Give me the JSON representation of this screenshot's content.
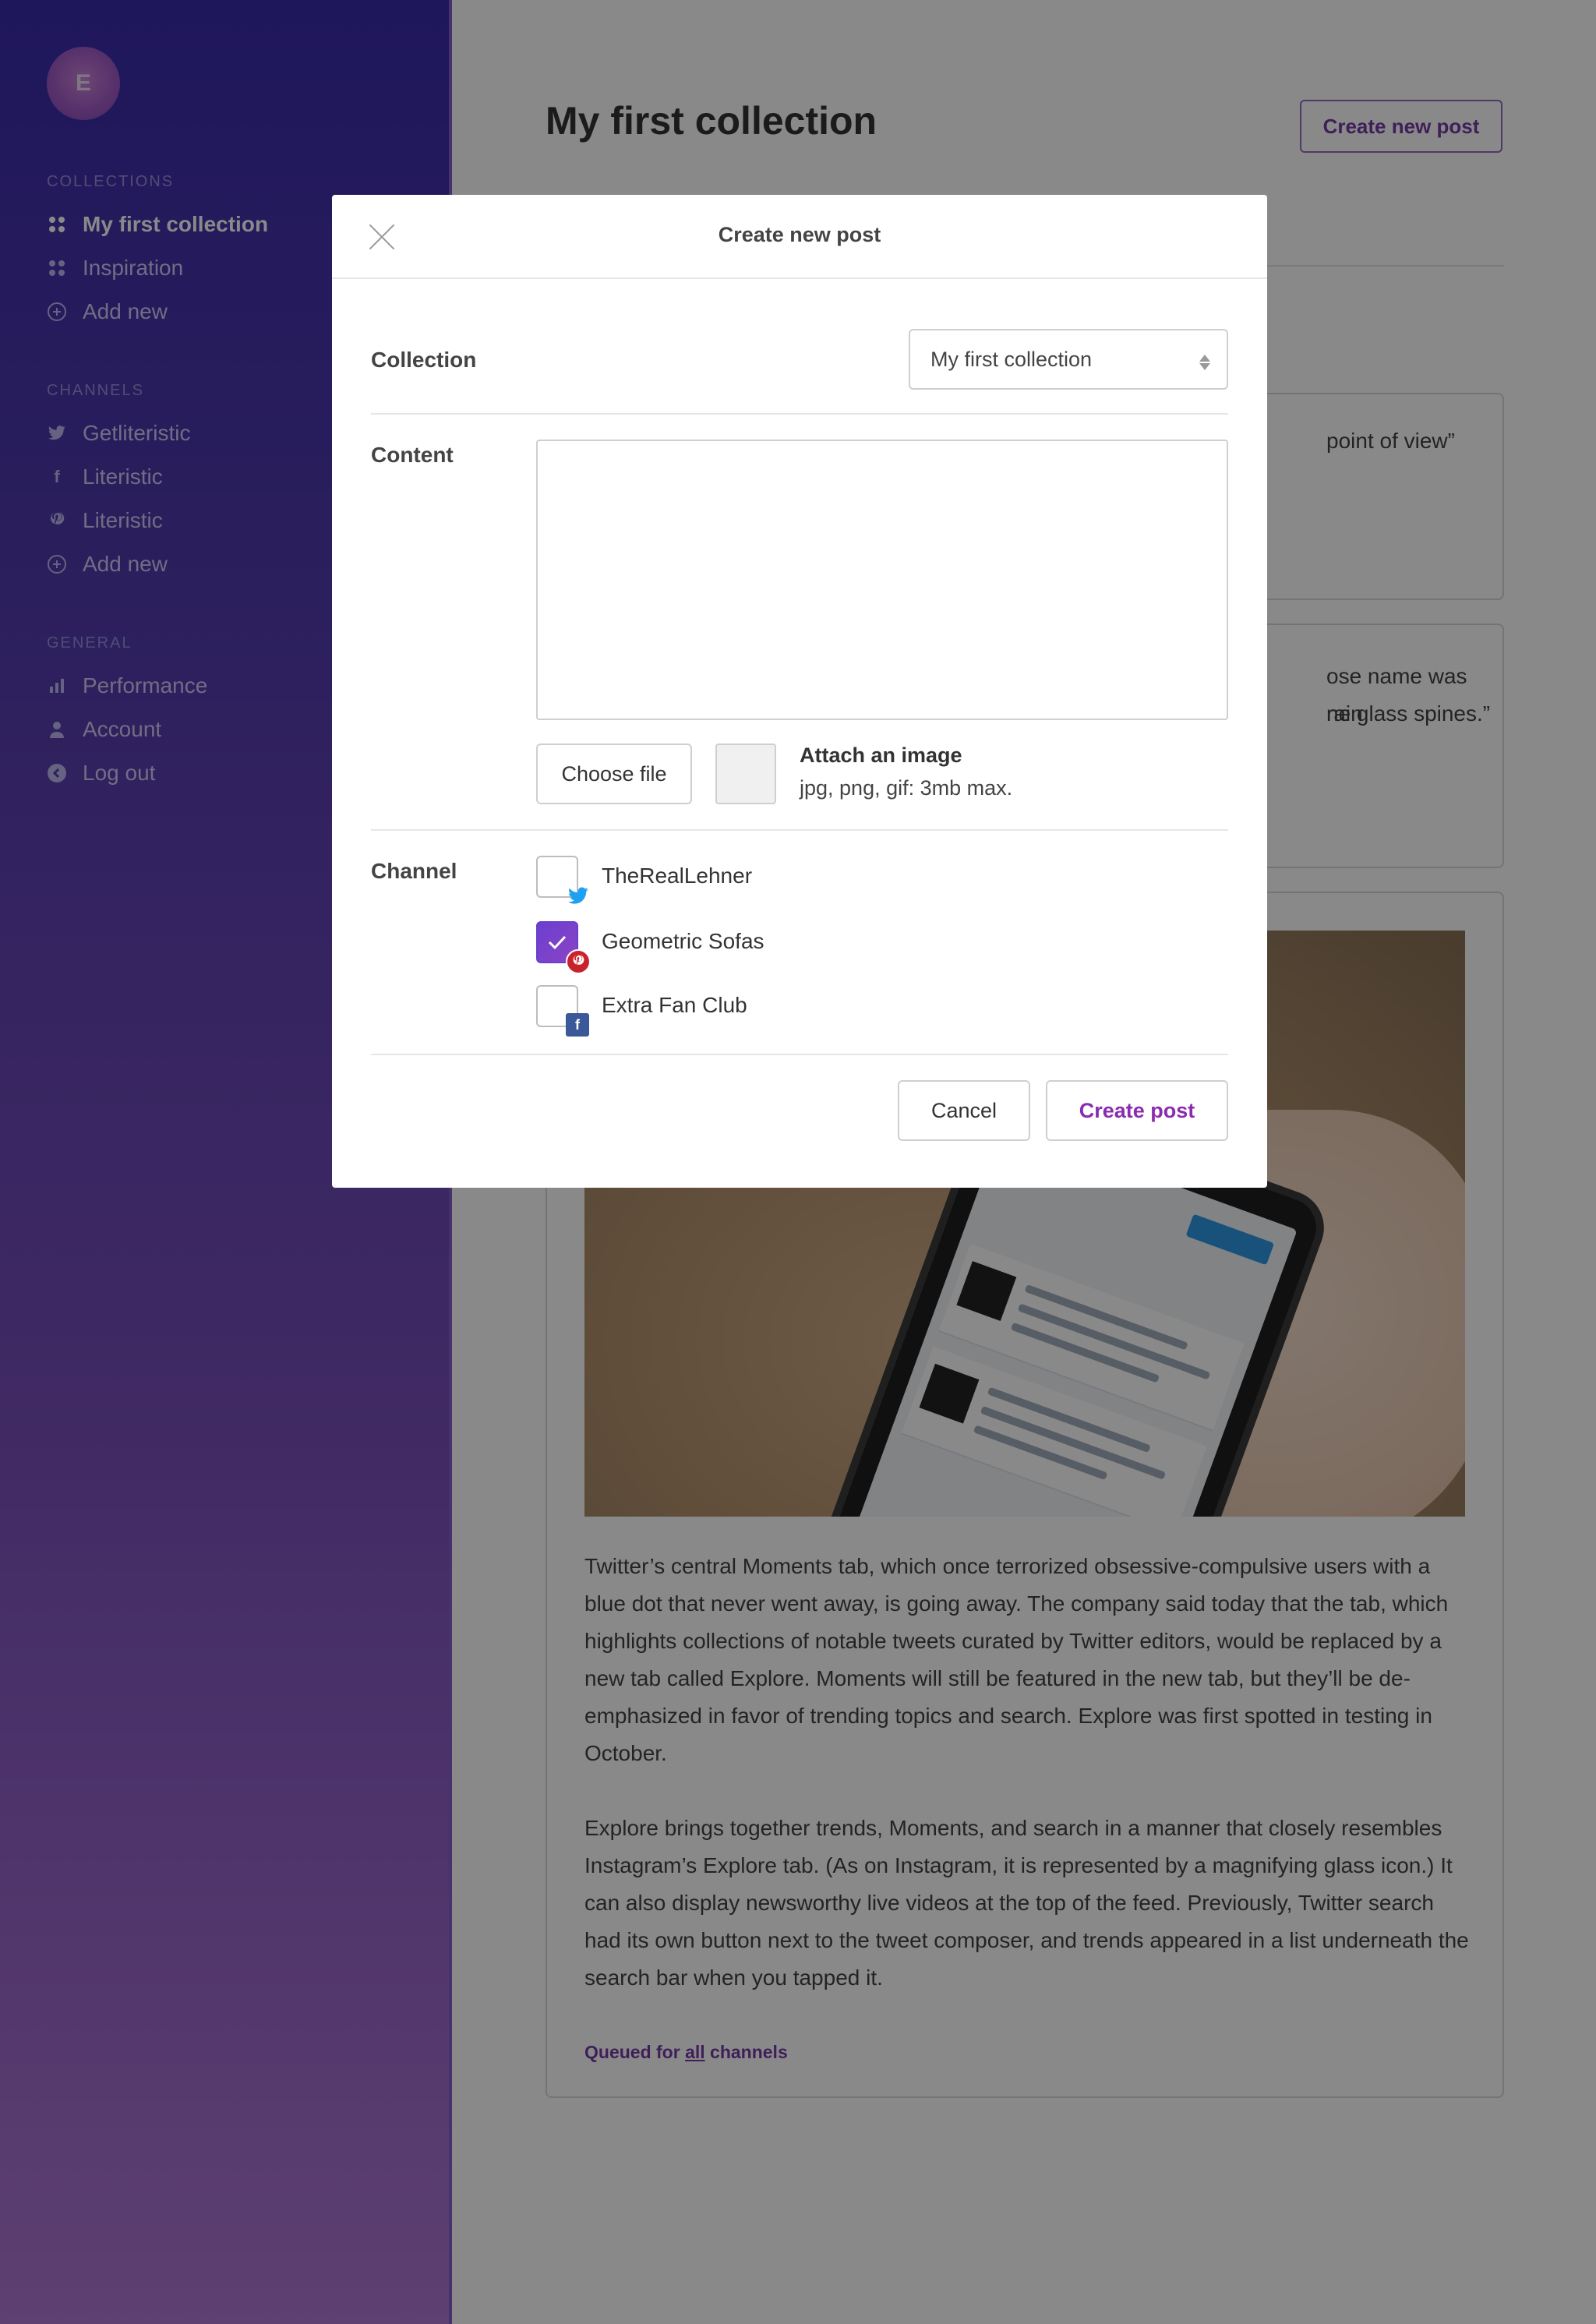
{
  "sidebar": {
    "avatar_letter": "E",
    "collections_title": "COLLECTIONS",
    "collections": [
      {
        "label": "My first collection",
        "active": true
      },
      {
        "label": "Inspiration",
        "active": false
      },
      {
        "label": "Add new",
        "active": false
      }
    ],
    "channels_title": "CHANNELS",
    "channels": [
      {
        "label": "Getliteristic",
        "icon": "twitter-icon"
      },
      {
        "label": "Literistic",
        "icon": "facebook-icon"
      },
      {
        "label": "Literistic",
        "icon": "pinterest-icon"
      },
      {
        "label": "Add new",
        "icon": "add-icon"
      }
    ],
    "general_title": "GENERAL",
    "general": [
      {
        "label": "Performance",
        "icon": "bar-chart-icon"
      },
      {
        "label": "Account",
        "icon": "user-icon"
      },
      {
        "label": "Log out",
        "icon": "logout-icon"
      }
    ]
  },
  "main": {
    "title": "My first collection",
    "create_button": "Create new post",
    "card1_snippet": "point of view”",
    "card2_snippet_line1": "ose name was rain",
    "card2_snippet_line2": "ne glass spines.”",
    "article_p1": "Twitter’s central Moments tab, which once terrorized obsessive-compulsive users with a blue dot that never went away, is going away. The company said today that the tab, which highlights collections of notable tweets curated by Twitter editors, would be replaced by a new tab called Explore. Moments will still be featured in the new tab, but they’ll be de-emphasized in favor of trending topics and search. Explore was first spotted in testing in October.",
    "article_p2": "Explore brings together trends, Moments, and search in a manner that closely resembles Instagram’s Explore tab. (As on Instagram, it is represented by a magnifying glass icon.) It can also display newsworthy live videos at the top of the feed. Previously, Twitter search had its own button next to the tweet composer, and trends appeared in a list underneath the search bar when you tapped it.",
    "queued_prefix": "Queued for ",
    "queued_link": "all",
    "queued_suffix": " channels"
  },
  "modal": {
    "title": "Create new post",
    "collection_label": "Collection",
    "collection_value": "My first collection",
    "content_label": "Content",
    "content_value": "",
    "choose_file": "Choose file",
    "attach_title": "Attach an image",
    "attach_hint": "jpg, png, gif: 3mb max.",
    "channel_label": "Channel",
    "channels": [
      {
        "name": "TheRealLehner",
        "network": "twitter",
        "checked": false
      },
      {
        "name": "Geometric Sofas",
        "network": "pinterest",
        "checked": true
      },
      {
        "name": "Extra Fan Club",
        "network": "facebook",
        "checked": false
      }
    ],
    "cancel": "Cancel",
    "create": "Create post"
  },
  "colors": {
    "accent": "#6a2b9c",
    "sidebar_top": "#2a1aa4",
    "sidebar_bottom": "#a86cd0",
    "checkbox_checked": "#6a3fd0"
  }
}
